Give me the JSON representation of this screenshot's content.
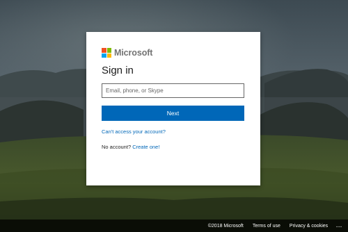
{
  "brand": {
    "name": "Microsoft",
    "logo_colors": [
      "#f25022",
      "#7fba00",
      "#00a4ef",
      "#ffb900"
    ]
  },
  "signin": {
    "title": "Sign in",
    "email_placeholder": "Email, phone, or Skype",
    "email_value": "",
    "next_label": "Next",
    "cant_access_label": "Can't access your account?",
    "no_account_text": "No account?",
    "create_label": "Create one!"
  },
  "footer": {
    "copyright": "©2018 Microsoft",
    "terms": "Terms of use",
    "privacy": "Privacy & cookies",
    "more": "..."
  },
  "colors": {
    "accent": "#0067b8",
    "link": "#0067b8",
    "card_bg": "#ffffff"
  }
}
